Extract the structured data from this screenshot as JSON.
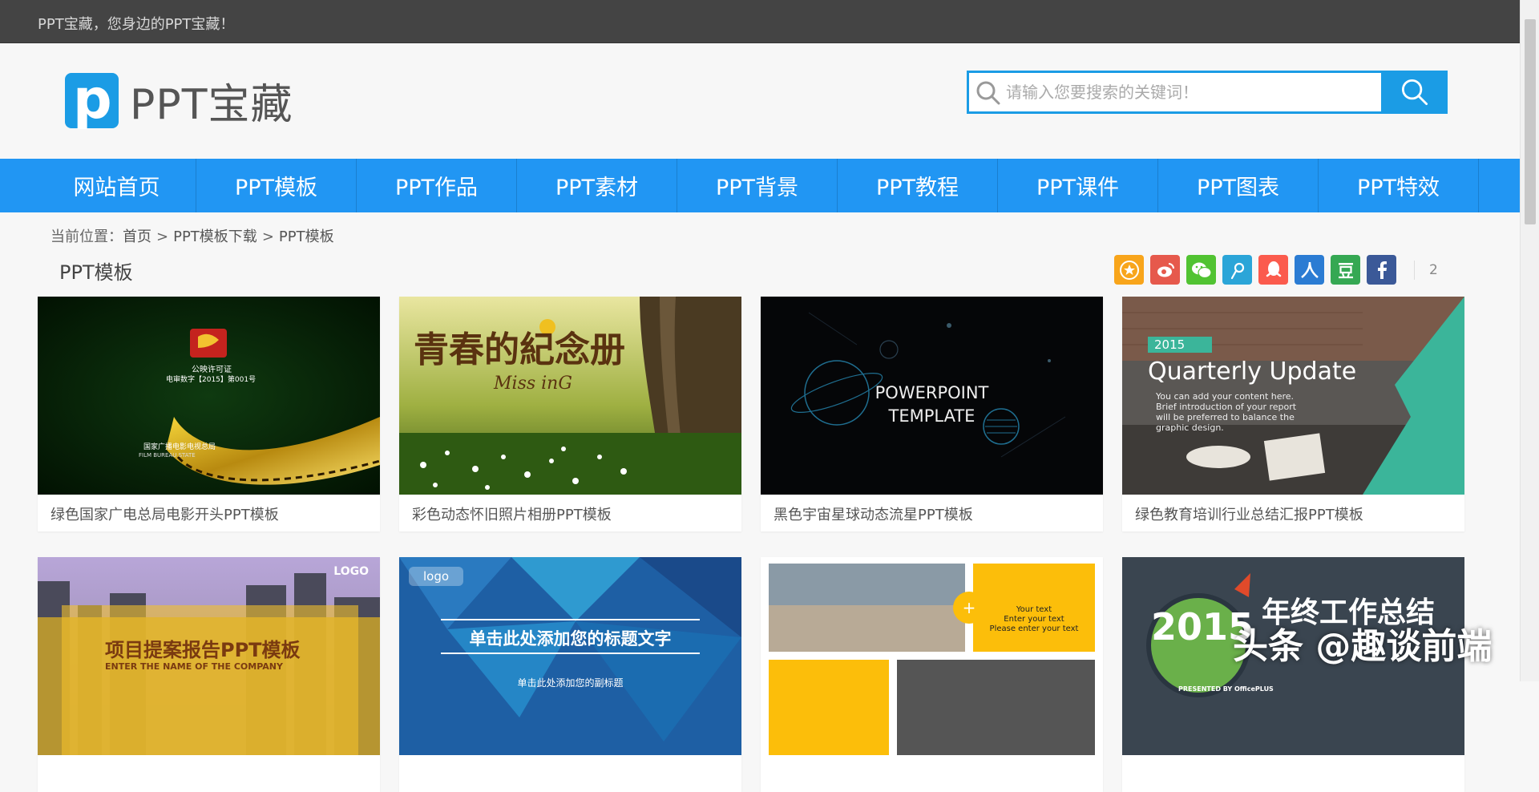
{
  "topbar": {
    "text": "PPT宝藏，您身边的PPT宝藏！"
  },
  "logo": {
    "letter": "p",
    "text": "PPT宝藏"
  },
  "search": {
    "placeholder": "请输入您要搜索的关键词！"
  },
  "nav": {
    "items": [
      "网站首页",
      "PPT模板",
      "PPT作品",
      "PPT素材",
      "PPT背景",
      "PPT教程",
      "PPT课件",
      "PPT图表",
      "PPT特效"
    ]
  },
  "breadcrumb": {
    "prefix": "当前位置：",
    "links": [
      "首页",
      "PPT模板下载",
      "PPT模板"
    ],
    "separator": ">"
  },
  "section": {
    "title": "PPT模板"
  },
  "share": {
    "icons": [
      "favorite-icon",
      "weibo-icon",
      "wechat-icon",
      "tencent-weibo-icon",
      "qq-icon",
      "renren-icon",
      "douban-icon",
      "facebook-icon"
    ],
    "count": "2"
  },
  "cards": [
    {
      "title": "绿色国家广电总局电影开头PPT模板",
      "thumb_text": [
        "公映许可证",
        "电审数字【2015】第001号",
        "国家广播电影电视总局",
        "FILM BUREAU STATE"
      ]
    },
    {
      "title": "彩色动态怀旧照片相册PPT模板",
      "thumb_text": [
        "青春的紀念册",
        "Miss inG"
      ]
    },
    {
      "title": "黑色宇宙星球动态流星PPT模板",
      "thumb_text": [
        "POWERPOINT",
        "TEMPLATE"
      ]
    },
    {
      "title": "绿色教育培训行业总结汇报PPT模板",
      "thumb_text": [
        "2015",
        "Quarterly Update",
        "You can add your content here. Brief introduction of your report will be preferred to balance the graphic design."
      ]
    },
    {
      "title": "",
      "thumb_text": [
        "LOGO",
        "项目提案报告PPT模板",
        "ENTER THE NAME OF THE COMPANY"
      ]
    },
    {
      "title": "",
      "thumb_text": [
        "logo",
        "单击此处添加您的标题文字",
        "单击此处添加您的副标题"
      ]
    },
    {
      "title": "",
      "thumb_text": [
        "Your text",
        "Enter your text",
        "Please enter your text"
      ]
    },
    {
      "title": "",
      "thumb_text": [
        "2015",
        "年终工作总结",
        "PRESENTED BY OfficePLUS"
      ]
    }
  ],
  "watermark": "头条 @趣谈前端",
  "colors": {
    "brand": "#2196f3",
    "topbar": "#444444"
  }
}
